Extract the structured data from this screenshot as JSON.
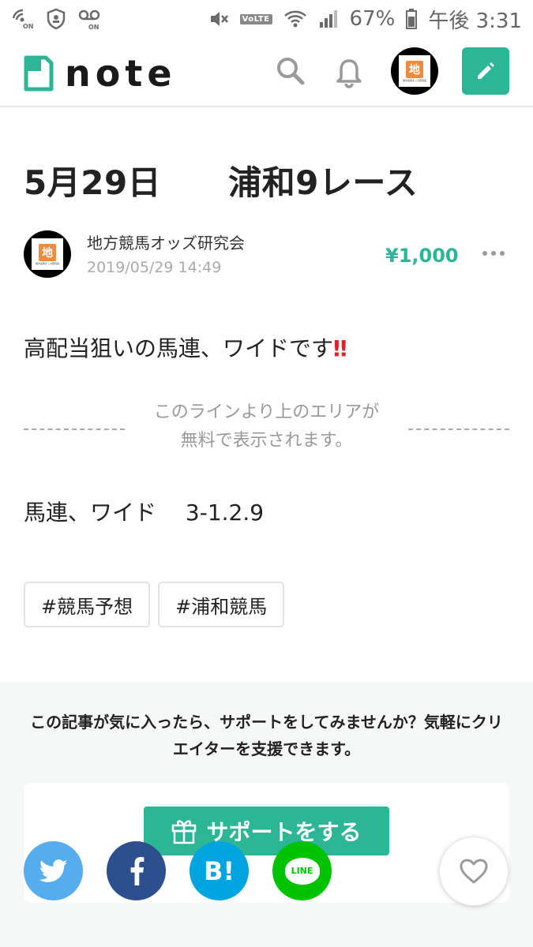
{
  "status_bar": {
    "battery": "67%",
    "time": "午後 3:31",
    "volte": "VoLTE",
    "on_label": "ON"
  },
  "header": {
    "logo": "note",
    "icons": [
      "search-icon",
      "bell-icon",
      "avatar",
      "pencil-icon"
    ]
  },
  "article": {
    "title": "5月29日　　浦和9レース",
    "author": "地方競馬オッズ研究会",
    "date": "2019/05/29 14:49",
    "price": "¥1,000",
    "lead": "高配当狙いの馬連、ワイドです",
    "lead_emoji": "‼",
    "free_line": "このラインより上のエリアが\n無料で表示されます。",
    "body": "馬連、ワイド　 3-1.2.9",
    "tags": [
      "#競馬予想",
      "#浦和競馬"
    ]
  },
  "avatar": {
    "glyph": "地",
    "caption": "地方競馬オッズ研究会"
  },
  "support": {
    "message": "この記事が気に入ったら、サポートをしてみませんか？気軽にクリエイターを支援できます。",
    "button_label": "サポートをする"
  },
  "share": {
    "hatena_label": "B!",
    "line_label": "LINE"
  },
  "colors": {
    "brand": "#2cb696",
    "twitter": "#55acee",
    "facebook": "#2d4f8e",
    "hatena": "#00a4de",
    "line": "#00c300",
    "exclaim": "#e0212a"
  }
}
